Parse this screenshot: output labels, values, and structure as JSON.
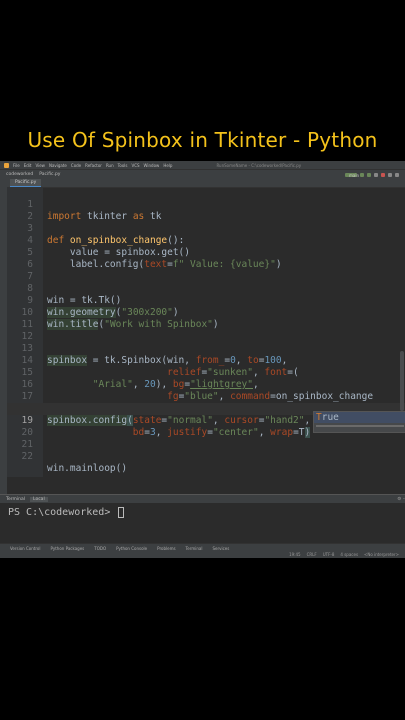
{
  "video_title": "Use Of Spinbox in Tkinter - Python",
  "menu": {
    "items": [
      "File",
      "Edit",
      "View",
      "Navigate",
      "Code",
      "Refactor",
      "Run",
      "Tools",
      "VCS",
      "Window",
      "Help"
    ],
    "window_title": "RunSomeName - C:\\codeworked\\Pacific.py"
  },
  "nav": {
    "project": "codeworked",
    "file": "Pacific.py",
    "run_config": "main"
  },
  "tabs": [
    {
      "label": "Pacific.py"
    }
  ],
  "code_lines": [
    {
      "n": "1"
    },
    {
      "n": "2"
    },
    {
      "n": "3"
    },
    {
      "n": "4"
    },
    {
      "n": "5"
    },
    {
      "n": "6"
    },
    {
      "n": "7"
    },
    {
      "n": "8"
    },
    {
      "n": "9"
    },
    {
      "n": "10"
    },
    {
      "n": "11"
    },
    {
      "n": "12"
    },
    {
      "n": "13"
    },
    {
      "n": "14"
    },
    {
      "n": "15"
    },
    {
      "n": "16"
    },
    {
      "n": "17"
    },
    {
      "n": "18"
    },
    {
      "n": "19"
    },
    {
      "n": "20"
    },
    {
      "n": "21"
    },
    {
      "n": "22"
    }
  ],
  "code": {
    "l1_kw": "import",
    "l1_mod": " tkinter ",
    "l1_as": "as",
    "l1_alias": " tk",
    "l3_def": "def",
    "l3_fn": "on_spinbox_change",
    "l3_rest": "():",
    "l4": "    value = spinbox.get()",
    "l5_a": "    label.config(",
    "l5_p": "text",
    "l5_b": "=",
    "l5_s": "f\" Value: {value}\"",
    "l5_c": ")",
    "l9": "win = tk.Tk()",
    "l10_a": "win.geometry",
    "l10_b": "(",
    "l10_s": "\"300x200\"",
    "l10_c": ")",
    "l11_a": "win.title",
    "l11_b": "(",
    "l11_s": "\"Work with Spinbox\"",
    "l11_c": ")",
    "l14_a": "spinbox",
    "l14_b": " = tk.Spinbox(win, ",
    "l14_p1": "from_",
    "l14_c": "=",
    "l14_n1": "0",
    "l14_d": ", ",
    "l14_p2": "to",
    "l14_e": "=",
    "l14_n2": "100",
    "l14_f": ",",
    "l15_ind": "                     ",
    "l15_p1": "relief",
    "l15_a": "=",
    "l15_s": "\"sunken\"",
    "l15_b": ", ",
    "l15_p2": "font",
    "l15_c": "=(",
    "l16_ind": "        ",
    "l16_s": "\"Arial\"",
    "l16_a": ", ",
    "l16_n": "20",
    "l16_b": "), ",
    "l16_p": "bg",
    "l16_c": "=",
    "l16_s2": "\"lightgrey\"",
    "l16_d": ",",
    "l17_ind": "                     ",
    "l17_p1": "fg",
    "l17_a": "=",
    "l17_s": "\"blue\"",
    "l17_b": ", ",
    "l17_p2": "command",
    "l17_c": "=on_spinbox_change",
    "l19_a": "spinbox.config",
    "l19_b": "(",
    "l19_p1": "state",
    "l19_c": "=",
    "l19_s1": "\"normal\"",
    "l19_d": ", ",
    "l19_p2": "cursor",
    "l19_e": "=",
    "l19_s2": "\"hand2\"",
    "l19_f": ",",
    "l20_ind": "               ",
    "l20_p1": "bd",
    "l20_a": "=",
    "l20_n": "3",
    "l20_b": ", ",
    "l20_p2": "justify",
    "l20_c": "=",
    "l20_s": "\"center\"",
    "l20_d": ", ",
    "l20_p3": "wrap",
    "l20_e": "=T",
    "l20_f": ")",
    "l23": "win.mainloop()"
  },
  "autocomplete": {
    "match": "T",
    "rest": "rue"
  },
  "terminal": {
    "tabs": [
      "Terminal",
      "Local"
    ],
    "prompt": "PS C:\\codeworked> "
  },
  "toolwindows": [
    "Version Control",
    "Python Packages",
    "TODO",
    "Python Console",
    "Problems",
    "Terminal",
    "Services"
  ],
  "status": [
    "19:45",
    "CRLF",
    "UTF-8",
    "4 spaces",
    "<No interpreter>"
  ]
}
